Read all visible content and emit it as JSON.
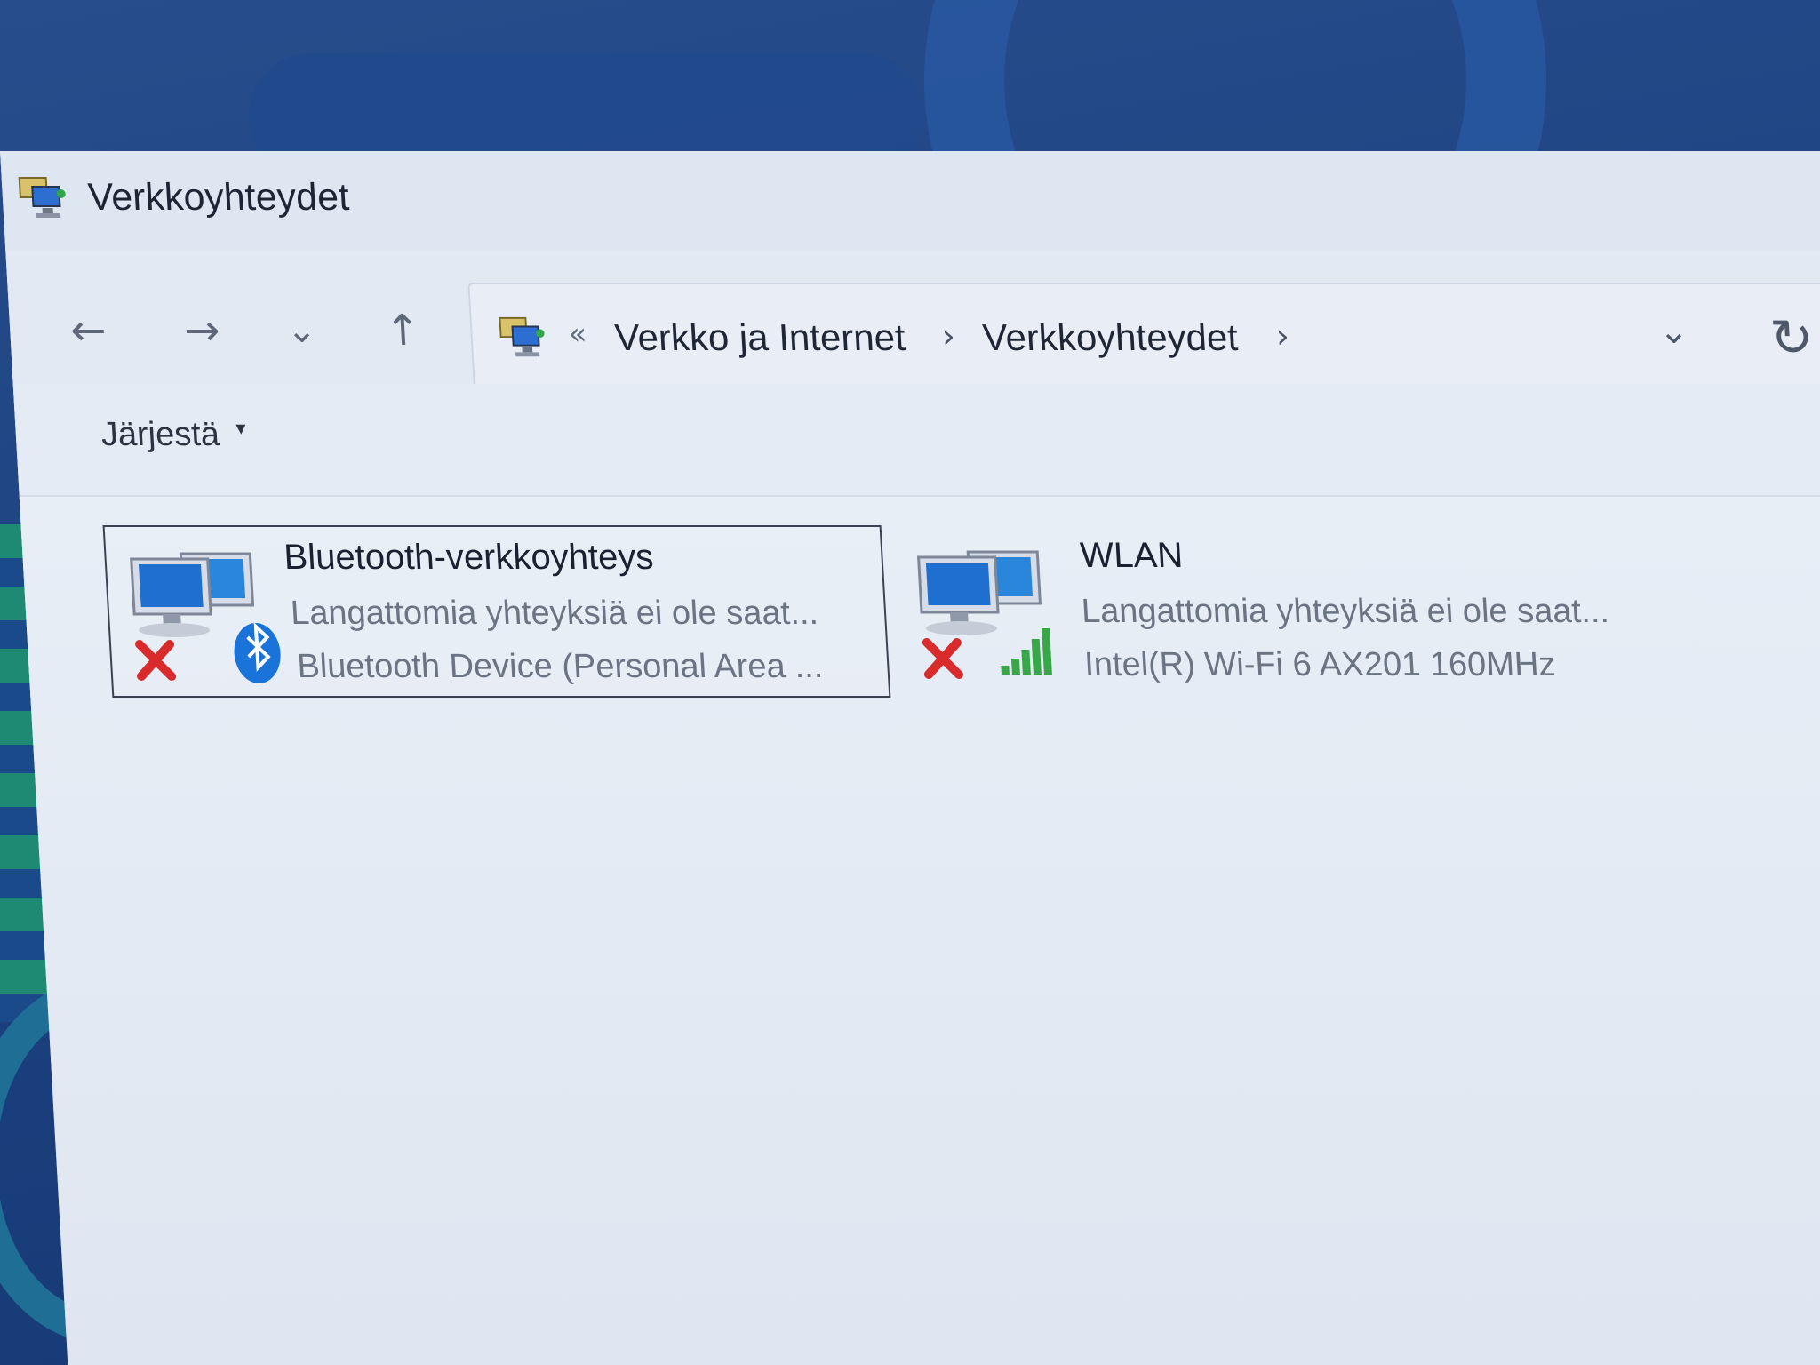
{
  "window": {
    "title": "Verkkoyhteydet",
    "app_icon": "network-connections-icon"
  },
  "nav": {
    "back_icon": "arrow-left-icon",
    "forward_icon": "arrow-right-icon",
    "recent_icon": "chevron-down-icon",
    "up_icon": "arrow-up-icon",
    "glyphs": {
      "back": "←",
      "forward": "→",
      "recent": "⌄",
      "up": "↑"
    }
  },
  "address": {
    "overflow": "«",
    "separator": "›",
    "crumbs": [
      "Verkko ja Internet",
      "Verkkoyhteydet"
    ],
    "dropdown_glyph": "⌄",
    "refresh_glyph": "↻"
  },
  "command_bar": {
    "organize_label": "Järjestä",
    "organize_caret": "▾"
  },
  "connections": [
    {
      "name": "Bluetooth-verkkoyhteys",
      "status": "Langattomia yhteyksiä ei ole saat...",
      "device": "Bluetooth Device (Personal Area ...",
      "icon": "bluetooth-icon",
      "selected": true
    },
    {
      "name": "WLAN",
      "status": "Langattomia yhteyksiä ei ole saat...",
      "device": "Intel(R) Wi-Fi 6 AX201 160MHz",
      "icon": "wifi-signal-icon",
      "selected": false
    }
  ],
  "colors": {
    "accent_blue": "#1a73d9",
    "error_red": "#d92b2b",
    "signal_green": "#3aa64a"
  }
}
